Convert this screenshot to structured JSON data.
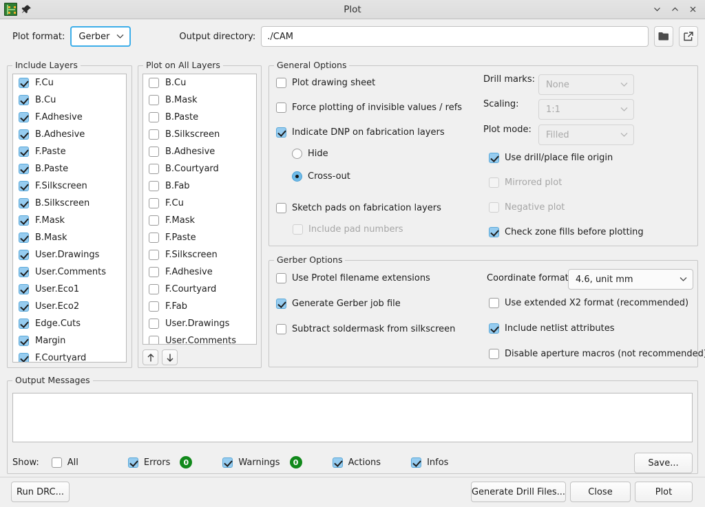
{
  "window": {
    "title": "Plot",
    "icon": "pcb-icon",
    "pin_icon": "pin-icon",
    "controls": [
      {
        "name": "minimize-button",
        "glyph": "chevron-down"
      },
      {
        "name": "maximize-button",
        "glyph": "chevron-up"
      },
      {
        "name": "close-button",
        "glyph": "x"
      }
    ]
  },
  "toolbar": {
    "plot_format_label": "Plot format:",
    "plot_format_value": "Gerber",
    "output_directory_label": "Output directory:",
    "output_directory_value": "./CAM",
    "browse_icon": "folder-icon",
    "open_icon": "open-external-icon"
  },
  "include_layers": {
    "title": "Include Layers",
    "items": [
      {
        "label": "F.Cu",
        "checked": true
      },
      {
        "label": "B.Cu",
        "checked": true
      },
      {
        "label": "F.Adhesive",
        "checked": true
      },
      {
        "label": "B.Adhesive",
        "checked": true
      },
      {
        "label": "F.Paste",
        "checked": true
      },
      {
        "label": "B.Paste",
        "checked": true
      },
      {
        "label": "F.Silkscreen",
        "checked": true
      },
      {
        "label": "B.Silkscreen",
        "checked": true
      },
      {
        "label": "F.Mask",
        "checked": true
      },
      {
        "label": "B.Mask",
        "checked": true
      },
      {
        "label": "User.Drawings",
        "checked": true
      },
      {
        "label": "User.Comments",
        "checked": true
      },
      {
        "label": "User.Eco1",
        "checked": true
      },
      {
        "label": "User.Eco2",
        "checked": true
      },
      {
        "label": "Edge.Cuts",
        "checked": true
      },
      {
        "label": "Margin",
        "checked": true
      },
      {
        "label": "F.Courtyard",
        "checked": true
      }
    ]
  },
  "plot_on_all_layers": {
    "title": "Plot on All Layers",
    "items": [
      {
        "label": "B.Cu",
        "checked": false
      },
      {
        "label": "B.Mask",
        "checked": false
      },
      {
        "label": "B.Paste",
        "checked": false
      },
      {
        "label": "B.Silkscreen",
        "checked": false
      },
      {
        "label": "B.Adhesive",
        "checked": false
      },
      {
        "label": "B.Courtyard",
        "checked": false
      },
      {
        "label": "B.Fab",
        "checked": false
      },
      {
        "label": "F.Cu",
        "checked": false
      },
      {
        "label": "F.Mask",
        "checked": false
      },
      {
        "label": "F.Paste",
        "checked": false
      },
      {
        "label": "F.Silkscreen",
        "checked": false
      },
      {
        "label": "F.Adhesive",
        "checked": false
      },
      {
        "label": "F.Courtyard",
        "checked": false
      },
      {
        "label": "F.Fab",
        "checked": false
      },
      {
        "label": "User.Drawings",
        "checked": false
      },
      {
        "label": "User.Comments",
        "checked": false
      }
    ],
    "move_up_icon": "arrow-up-icon",
    "move_down_icon": "arrow-down-icon"
  },
  "general_options": {
    "title": "General Options",
    "left": [
      {
        "label": "Plot drawing sheet",
        "checked": false,
        "disabled": false
      },
      {
        "label": "Force plotting of invisible values / refs",
        "checked": false,
        "disabled": false
      },
      {
        "label": "Indicate DNP on fabrication layers",
        "checked": true,
        "disabled": false
      }
    ],
    "dnp_radio": [
      {
        "label": "Hide",
        "selected": false
      },
      {
        "label": "Cross-out",
        "selected": true
      }
    ],
    "sketch": {
      "label": "Sketch pads on fabrication layers",
      "checked": false,
      "disabled": false
    },
    "pad_numbers": {
      "label": "Include pad numbers",
      "checked": false,
      "disabled": true
    },
    "drill_marks_label": "Drill marks:",
    "drill_marks_value": "None",
    "scaling_label": "Scaling:",
    "scaling_value": "1:1",
    "plot_mode_label": "Plot mode:",
    "plot_mode_value": "Filled",
    "right": [
      {
        "label": "Use drill/place file origin",
        "checked": true,
        "disabled": false
      },
      {
        "label": "Mirrored plot",
        "checked": false,
        "disabled": true
      },
      {
        "label": "Negative plot",
        "checked": false,
        "disabled": true
      },
      {
        "label": "Check zone fills before plotting",
        "checked": true,
        "disabled": false
      }
    ]
  },
  "gerber_options": {
    "title": "Gerber Options",
    "left": [
      {
        "label": "Use Protel filename extensions",
        "checked": false
      },
      {
        "label": "Generate Gerber job file",
        "checked": true
      },
      {
        "label": "Subtract soldermask from silkscreen",
        "checked": false
      }
    ],
    "coordinate_format_label": "Coordinate format:",
    "coordinate_format_value": "4.6, unit mm",
    "right": [
      {
        "label": "Use extended X2 format (recommended)",
        "checked": false
      },
      {
        "label": "Include netlist attributes",
        "checked": true
      },
      {
        "label": "Disable aperture macros (not recommended)",
        "checked": false
      }
    ]
  },
  "output_messages": {
    "title": "Output Messages",
    "content": "",
    "show_label": "Show:",
    "filters": [
      {
        "label": "All",
        "checked": false,
        "count": null
      },
      {
        "label": "Errors",
        "checked": true,
        "count": "0"
      },
      {
        "label": "Warnings",
        "checked": true,
        "count": "0"
      },
      {
        "label": "Actions",
        "checked": true,
        "count": null
      },
      {
        "label": "Infos",
        "checked": true,
        "count": null
      }
    ],
    "save_label": "Save..."
  },
  "footer": {
    "run_drc_label": "Run DRC...",
    "generate_drill_label": "Generate Drill Files...",
    "close_label": "Close",
    "plot_label": "Plot"
  },
  "colors": {
    "background": "#f0f0f0",
    "checkbox_on": "#96ccf0",
    "accent_focus": "#3daee9",
    "badge_green": "#11891b"
  }
}
